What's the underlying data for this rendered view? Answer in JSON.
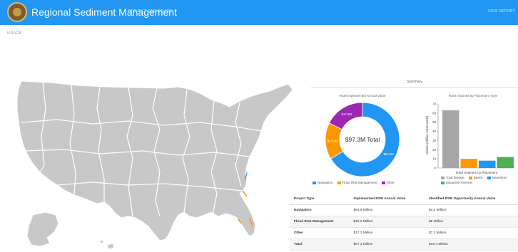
{
  "header": {
    "title": "Regional Sediment Management",
    "nav_dashboard": "PROJECT DASHBOARD",
    "nav_right": "VIEW REPORT",
    "bar_color": "#2196f3"
  },
  "breadcrumb": "USACE",
  "summary": {
    "title": "Summary"
  },
  "chart_data": [
    {
      "type": "pie",
      "title": "RSM Implemented Annual Value",
      "center_label": "$97.3M Total",
      "categories": [
        "Navigation",
        "Flood Risk Management",
        "Other"
      ],
      "values": [
        64.5,
        15.6,
        17.2
      ],
      "data_labels": [
        "$64.5M",
        "$15.6M",
        "$17.2M"
      ],
      "colors": [
        "#2196f3",
        "#ff9800",
        "#9c27b0"
      ],
      "legend": "bottom"
    },
    {
      "type": "bar",
      "title": "RSM Volumes by Placement Type",
      "xlabel": "RSM Volumes by Placement",
      "ylabel": "Volume (Million Cubic Yards)",
      "categories": [
        "Total Dredge",
        "Beach",
        "Nearshore",
        "Estuarine-Riverine"
      ],
      "values": [
        63,
        10,
        8,
        12
      ],
      "colors": [
        "#a6a6a6",
        "#ff9800",
        "#2196f3",
        "#4caf50"
      ],
      "ylim": [
        0,
        70
      ],
      "yticks": [
        0,
        10,
        20,
        30,
        40,
        50,
        60,
        70
      ],
      "grid": false,
      "legend": "bottom"
    }
  ],
  "table": {
    "headers": [
      "Project Type",
      "Implemented RSM Annual Value",
      "Identified RSM Opportunity Annual Value"
    ],
    "rows": [
      [
        "Navigation",
        "$64.5 Million",
        "$4.2 Million"
      ],
      [
        "Flood Risk Management",
        "$15.6 Million",
        "$5 Million"
      ],
      [
        "Other",
        "$17.2 Million",
        "$7.2 Million"
      ],
      [
        "Total",
        "$97.3 Million",
        "$16.4 Million"
      ]
    ]
  },
  "map": {
    "land_color": "#c8c8c8",
    "border_color": "#ffffff",
    "coast_highlight": "#ff9800"
  }
}
